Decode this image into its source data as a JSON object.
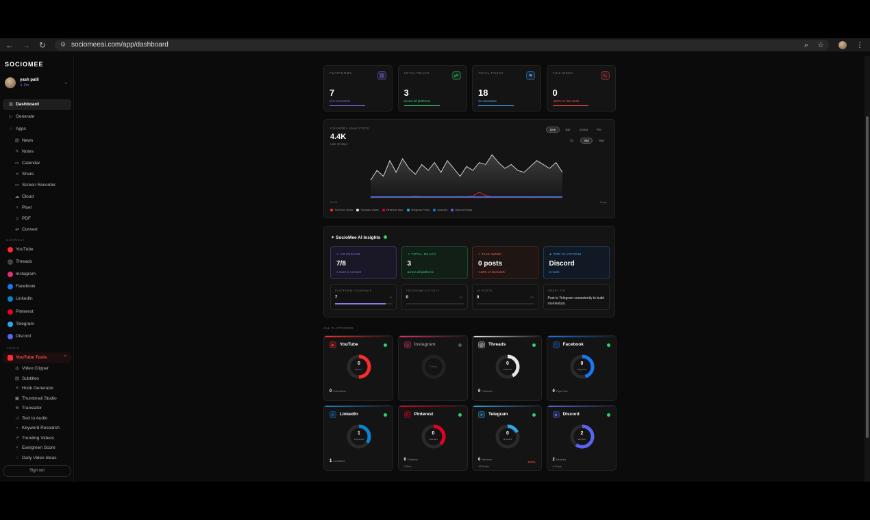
{
  "browser": {
    "url": "sociomeeai.com/app/dashboard"
  },
  "sidebar": {
    "brand": "SOCIOMEE",
    "user": {
      "name": "yash patil",
      "plan": "✦ Pro"
    },
    "main": [
      {
        "label": "Dashboard",
        "icon": "grid-icon"
      },
      {
        "label": "Generate",
        "icon": "play-icon"
      },
      {
        "label": "Apps",
        "icon": "circle-icon"
      }
    ],
    "apps": [
      {
        "label": "News"
      },
      {
        "label": "Notes"
      },
      {
        "label": "Calendar"
      },
      {
        "label": "Share"
      },
      {
        "label": "Screen Recorder"
      },
      {
        "label": "Cloud"
      },
      {
        "label": "Pixel"
      },
      {
        "label": "PDF"
      },
      {
        "label": "Convert"
      }
    ],
    "connect_label": "CONNECT",
    "connect": [
      {
        "label": "YouTube",
        "color": "#ff2b2b"
      },
      {
        "label": "Threads",
        "color": "#444444"
      },
      {
        "label": "Instagram",
        "color": "#e1306c"
      },
      {
        "label": "Facebook",
        "color": "#1877f2"
      },
      {
        "label": "LinkedIn",
        "color": "#0a84d0"
      },
      {
        "label": "Pinterest",
        "color": "#e60023"
      },
      {
        "label": "Telegram",
        "color": "#29a9eb"
      },
      {
        "label": "Discord",
        "color": "#5865f2"
      }
    ],
    "tools_label": "TOOLS",
    "tools_head": "YouTube Tools",
    "tools": [
      {
        "label": "Video Clipper"
      },
      {
        "label": "Subtitles"
      },
      {
        "label": "Hook Generator"
      },
      {
        "label": "Thumbnail Studio"
      },
      {
        "label": "Translator"
      },
      {
        "label": "Text to Audio"
      },
      {
        "label": "Keyword Research"
      },
      {
        "label": "Trending Videos"
      },
      {
        "label": "Evergreen Score"
      },
      {
        "label": "Daily Video Ideas"
      }
    ],
    "signout": "Sign out"
  },
  "stats": [
    {
      "label": "PLATFORMS",
      "value": "7",
      "sub": "of 8 connected",
      "accent": "#8a6cf0"
    },
    {
      "label": "TOTAL REACH",
      "value": "3",
      "sub": "across all platforms",
      "accent": "#2dd36f"
    },
    {
      "label": "TOTAL POSTS",
      "value": "18",
      "sub": "via SocioMee",
      "accent": "#4aa3ff"
    },
    {
      "label": "THIS WEEK",
      "value": "0",
      "sub": "-100% vs last week",
      "accent": "#ff4d4d"
    }
  ],
  "analytics": {
    "label": "CHANNEL ANALYTICS",
    "value": "4.4K",
    "sub": "Last 30 days",
    "chart_types": [
      "Line",
      "Bar",
      "Donut",
      "Pie"
    ],
    "chart_type_selected": "Line",
    "ranges": [
      "7d",
      "30d",
      "90d"
    ],
    "range_selected": "30d",
    "x_start": "01-10",
    "x_end": "Today"
  },
  "chart_data": {
    "type": "area",
    "series": [
      {
        "name": "YouTube Views",
        "color": "#ff2b2b",
        "values": [
          20,
          40,
          60,
          40,
          50,
          40,
          60,
          80,
          60,
          40,
          60,
          50,
          60,
          40,
          70,
          60,
          90,
          280,
          120,
          50,
          40,
          60,
          40,
          50,
          40,
          30,
          40,
          50,
          40,
          30,
          40
        ]
      },
      {
        "name": "Threads Views",
        "color": "#e6e6e6",
        "values": [
          900,
          1400,
          1100,
          1900,
          1300,
          2000,
          1500,
          1200,
          1700,
          1400,
          1800,
          1300,
          1900,
          1500,
          1100,
          1600,
          1400,
          1800,
          1700,
          2200,
          1800,
          1500,
          1700,
          1400,
          1300,
          1600,
          1900,
          1700,
          1500,
          1800,
          1300
        ]
      },
      {
        "name": "Pinterest Impr",
        "color": "#e60023",
        "values": [
          0,
          0,
          0,
          0,
          0,
          0,
          0,
          0,
          0,
          0,
          0,
          0,
          0,
          0,
          0,
          0,
          0,
          0,
          0,
          0,
          0,
          0,
          0,
          0,
          0,
          0,
          0,
          0,
          0,
          0,
          0
        ]
      },
      {
        "name": "Telegram Posts",
        "color": "#29a9eb",
        "values": [
          0,
          0,
          0,
          0,
          0,
          0,
          0,
          0,
          0,
          0,
          0,
          0,
          0,
          0,
          0,
          0,
          0,
          0,
          0,
          0,
          0,
          0,
          0,
          0,
          0,
          0,
          0,
          0,
          0,
          0,
          0
        ]
      },
      {
        "name": "LinkedIn",
        "color": "#0a84d0",
        "values": [
          0,
          0,
          0,
          0,
          0,
          0,
          0,
          0,
          0,
          0,
          0,
          0,
          0,
          0,
          0,
          0,
          0,
          0,
          0,
          0,
          0,
          0,
          0,
          0,
          0,
          0,
          0,
          0,
          0,
          0,
          0
        ]
      },
      {
        "name": "Discord Posts",
        "color": "#5865f2",
        "values": [
          0,
          0,
          0,
          0,
          0,
          0,
          0,
          0,
          0,
          0,
          0,
          0,
          0,
          0,
          0,
          0,
          0,
          0,
          0,
          0,
          0,
          0,
          0,
          0,
          0,
          0,
          0,
          0,
          0,
          0,
          0
        ]
      }
    ],
    "xlabel": "",
    "ylabel": "",
    "grid": false,
    "legend_position": "bottom"
  },
  "insights": {
    "title": "✦ SocioMee AI Insights",
    "cards": [
      {
        "label": "✦ COVERAGE",
        "value": "7/8",
        "sub": "1 more to connect",
        "color": "#8a6cf0",
        "bg": "#1a1726",
        "border": "#3a3163"
      },
      {
        "label": "↗ TOTAL REACH",
        "value": "3",
        "sub": "across all platforms",
        "color": "#2dd36f",
        "bg": "#111f17",
        "border": "#1f4a2f"
      },
      {
        "label": "⚡ THIS WEEK",
        "value": "0 posts",
        "sub": "-100% vs last week",
        "color": "#ff6a4d",
        "bg": "#1f1513",
        "border": "#4a2520"
      },
      {
        "label": "★ TOP PLATFORM",
        "value": "Discord",
        "sub": "2 reach",
        "color": "#4aa3ff",
        "bg": "#111a24",
        "border": "#1f3a57"
      }
    ],
    "mini": [
      {
        "label": "PLATFORM COVERAGE",
        "value": "7",
        "max": "/8",
        "fill": 0.875
      },
      {
        "label": "TELEGRAM ACTIVITY",
        "value": "0",
        "max": "/10",
        "fill": 0
      },
      {
        "label": "IG POSTS",
        "value": "0",
        "max": "/20",
        "fill": 0
      }
    ],
    "tip_label": "SMART TIP",
    "tip": "Post to Telegram consistently to build momentum."
  },
  "all_platforms_label": "ALL PLATFORMS",
  "platforms": [
    {
      "name": "YouTube",
      "color": "#ff2b2b",
      "badge": "▶",
      "status": "#2dd36f",
      "ring": "0",
      "ring_label": "Subscri...",
      "fill": 0.5,
      "foot": "0",
      "foot_label": "Subscribers",
      "foot2": "",
      "change": "",
      "offline": false,
      "icon": "youtube-icon"
    },
    {
      "name": "Instagram",
      "color": "#e1306c",
      "badge": "◎",
      "status": "#555555",
      "ring": "",
      "ring_label": "Offline",
      "fill": 0,
      "foot": "",
      "foot_label": "",
      "foot2": "",
      "change": "",
      "offline": true,
      "icon": "instagram-icon"
    },
    {
      "name": "Threads",
      "color": "#e6e6e6",
      "badge": "@",
      "status": "#2dd36f",
      "ring": "0",
      "ring_label": "Followers",
      "fill": 0.42,
      "foot": "0",
      "foot_label": "Followers",
      "foot2": "",
      "change": "",
      "offline": false,
      "icon": "threads-icon"
    },
    {
      "name": "Facebook",
      "color": "#1877f2",
      "badge": "f",
      "status": "#2dd36f",
      "ring": "0",
      "ring_label": "Page Fans",
      "fill": 0.45,
      "foot": "0",
      "foot_label": "Page Fans",
      "foot2": "",
      "change": "",
      "offline": false,
      "icon": "facebook-icon"
    },
    {
      "name": "LinkedIn",
      "color": "#0a84d0",
      "badge": "in",
      "status": "#2dd36f",
      "ring": "1",
      "ring_label": "Connected",
      "fill": 0.35,
      "foot": "1",
      "foot_label": "Connected",
      "foot2": "",
      "change": "",
      "offline": false,
      "icon": "linkedin-icon"
    },
    {
      "name": "Pinterest",
      "color": "#e60023",
      "badge": "P",
      "status": "#2dd36f",
      "ring": "0",
      "ring_label": "Followers",
      "fill": 0.38,
      "foot": "0",
      "foot_label": "Followers",
      "foot2": "2 Pins",
      "change": "",
      "offline": false,
      "icon": "pinterest-icon"
    },
    {
      "name": "Telegram",
      "color": "#29a9eb",
      "badge": "➤",
      "status": "#2dd36f",
      "ring": "0",
      "ring_label": "Members",
      "fill": 0.18,
      "foot": "0",
      "foot_label": "Members",
      "foot2": "18 Posts",
      "change": "-100%",
      "offline": false,
      "icon": "telegram-icon"
    },
    {
      "name": "Discord",
      "color": "#5865f2",
      "badge": "◆",
      "status": "#2dd36f",
      "ring": "2",
      "ring_label": "Members",
      "fill": 0.6,
      "foot": "2",
      "foot_label": "Members",
      "foot2": "0 Posts",
      "change": "",
      "offline": false,
      "icon": "discord-icon"
    }
  ]
}
